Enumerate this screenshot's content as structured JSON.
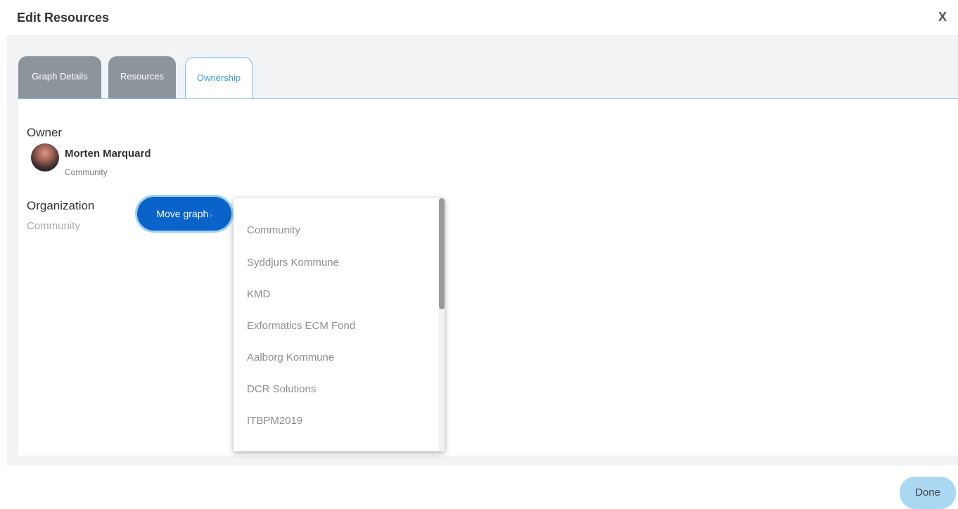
{
  "dialog": {
    "title": "Edit Resources",
    "close_label": "X"
  },
  "tabs": [
    {
      "label": "Graph Details",
      "active": false
    },
    {
      "label": "Resources",
      "active": false
    },
    {
      "label": "Ownership",
      "active": true
    }
  ],
  "owner": {
    "heading": "Owner",
    "name": "Morten Marquard",
    "organization": "Community"
  },
  "organization": {
    "heading": "Organization",
    "value": "Community",
    "move_button_label": "Move graph",
    "move_button_chevron": "›"
  },
  "dropdown": {
    "items": [
      "Community",
      "Syddjurs Kommune",
      "KMD",
      "Exformatics ECM Fond",
      "Aalborg Kommune",
      "DCR Solutions",
      "ITBPM2019"
    ]
  },
  "footer": {
    "done_label": "Done"
  },
  "colors": {
    "accent": "#0a63c9",
    "tab_inactive": "#8d959c",
    "active_tab_text": "#3b9ee6",
    "done_button": "#aad8f3"
  }
}
